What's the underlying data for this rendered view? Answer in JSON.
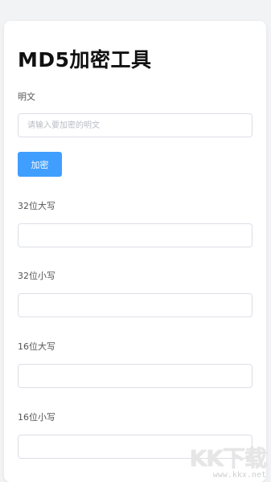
{
  "page": {
    "title": "MD5加密工具"
  },
  "form": {
    "plaintext_label": "明文",
    "plaintext_placeholder": "请输入要加密的明文",
    "plaintext_value": "",
    "encrypt_button": "加密",
    "upper32_label": "32位大写",
    "upper32_value": "",
    "lower32_label": "32位小写",
    "lower32_value": "",
    "upper16_label": "16位大写",
    "upper16_value": "",
    "lower16_label": "16位小写",
    "lower16_value": ""
  },
  "watermark": {
    "logo": "KK下载",
    "url": "www.kkx.net"
  },
  "colors": {
    "accent": "#409eff",
    "background": "#f2f3f5",
    "card": "#ffffff",
    "border": "#dcdfe6"
  }
}
